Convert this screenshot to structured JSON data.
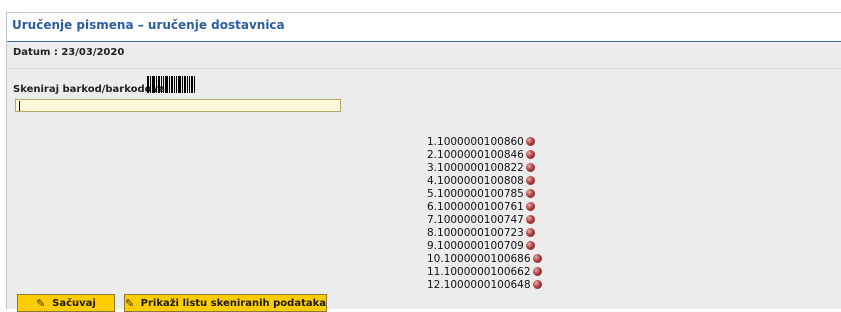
{
  "window": {
    "title": "Uručenje pismena – uručenje dostavnica"
  },
  "form": {
    "date_label": "Datum : 23/03/2020",
    "scan_label": "Skeniraj barkod/barkodove",
    "scan_input_value": "",
    "barcode_icon": "barcode-icon"
  },
  "scanned_list": [
    {
      "text": "1.1000000100860",
      "status_icon": "red-dot-icon"
    },
    {
      "text": "2.1000000100846",
      "status_icon": "red-dot-icon"
    },
    {
      "text": "3.1000000100822",
      "status_icon": "red-dot-icon"
    },
    {
      "text": "4.1000000100808",
      "status_icon": "red-dot-icon"
    },
    {
      "text": "5.1000000100785",
      "status_icon": "red-dot-icon"
    },
    {
      "text": "6.1000000100761",
      "status_icon": "red-dot-icon"
    },
    {
      "text": "7.1000000100747",
      "status_icon": "red-dot-icon"
    },
    {
      "text": "8.1000000100723",
      "status_icon": "red-dot-icon"
    },
    {
      "text": "9.1000000100709",
      "status_icon": "red-dot-icon"
    },
    {
      "text": "10.1000000100686",
      "status_icon": "red-dot-icon"
    },
    {
      "text": "11.1000000100662",
      "status_icon": "red-dot-icon"
    },
    {
      "text": "12.1000000100648",
      "status_icon": "red-dot-icon"
    }
  ],
  "buttons": {
    "save_label": "Sačuvaj",
    "show_list_label": "Prikaži listu skeniranih podataka",
    "icon": "edit-pencil-icon"
  },
  "colors": {
    "title": "#2d5da1",
    "button_bg": "#ffcc00",
    "input_bg": "#fff8d9",
    "status_dot": "#b13f3f"
  }
}
